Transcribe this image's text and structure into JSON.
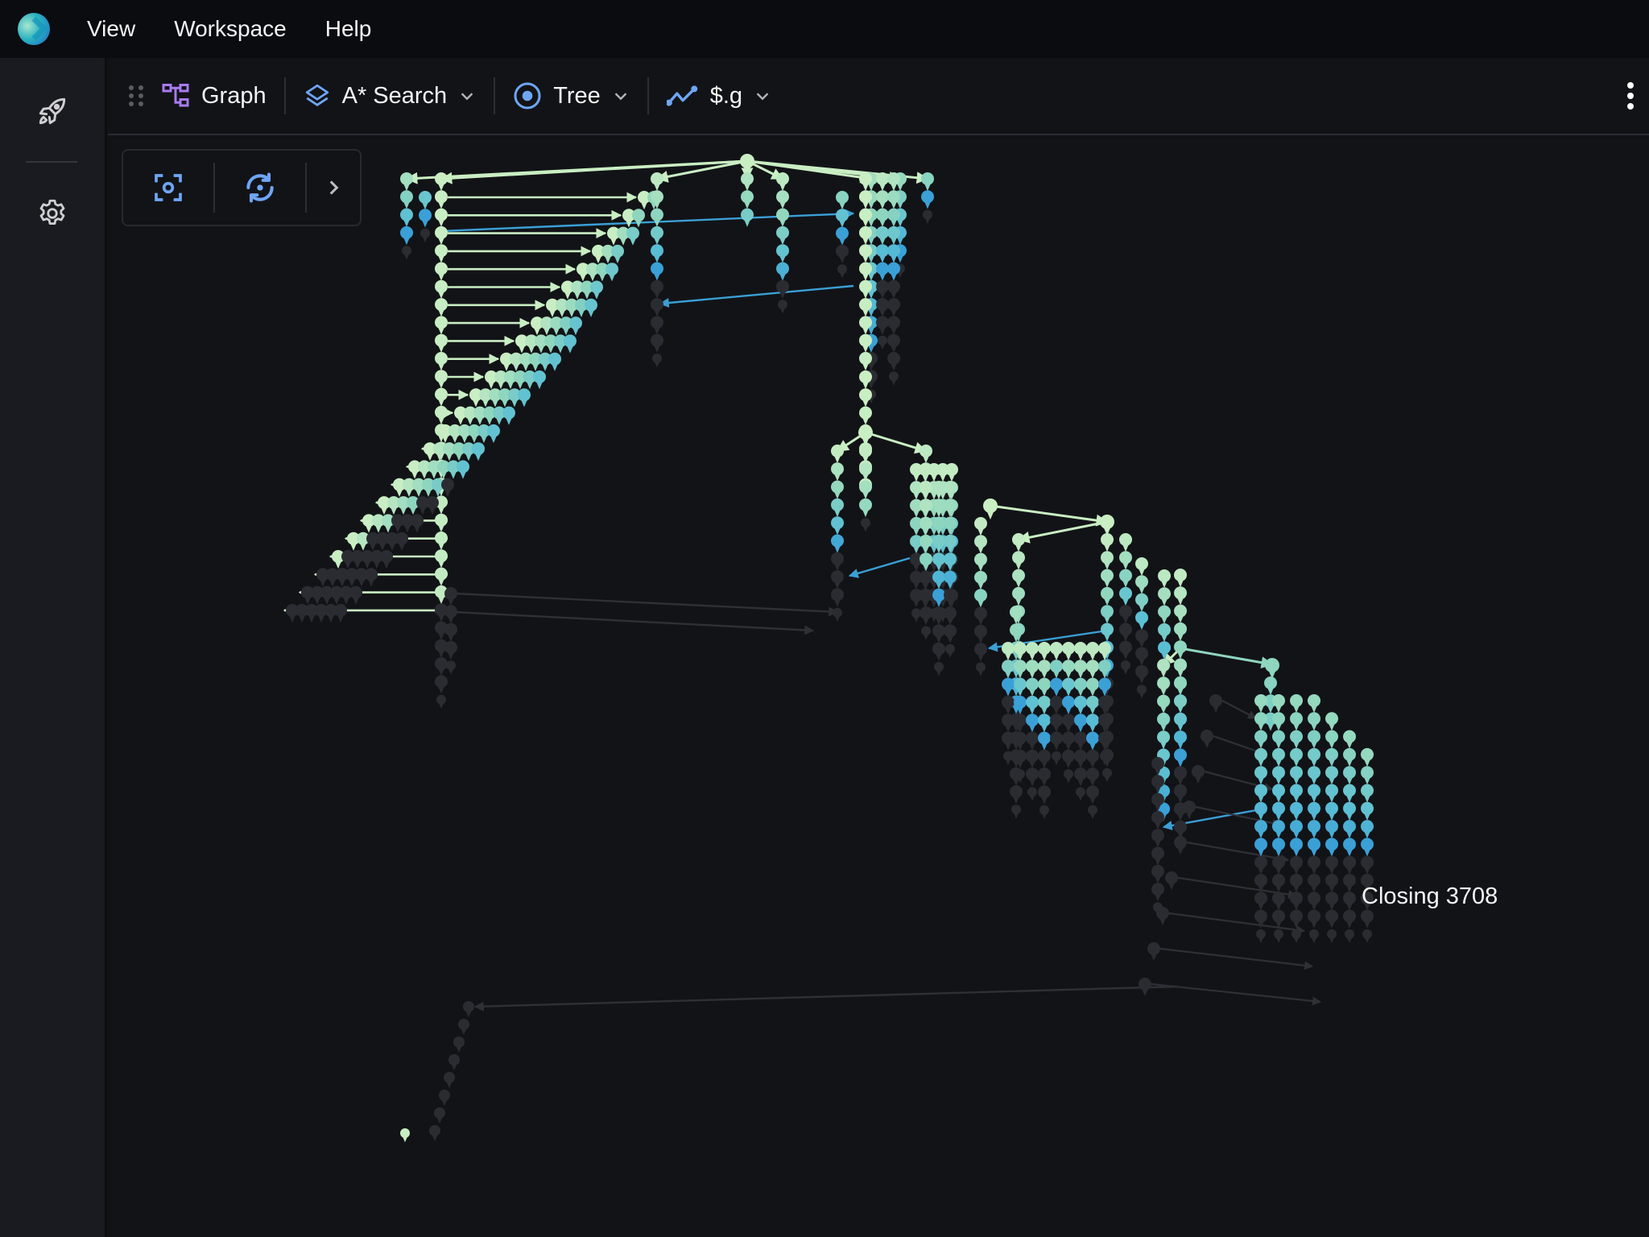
{
  "menubar": {
    "logo": "app-logo",
    "items": [
      {
        "label": "View"
      },
      {
        "label": "Workspace"
      },
      {
        "label": "Help"
      }
    ]
  },
  "sidebar": {
    "items": [
      {
        "icon": "rocket-icon",
        "name": "launch"
      },
      {
        "icon": "gear-icon",
        "name": "settings"
      }
    ]
  },
  "toolbar": {
    "graph_label": "Graph",
    "algorithm": {
      "label": "A* Search",
      "icon": "layers-icon"
    },
    "layout": {
      "label": "Tree",
      "icon": "target-icon"
    },
    "metric": {
      "label": "$.g",
      "icon": "line-chart-icon"
    }
  },
  "view_tools": {
    "fit_view": "focus-frame-icon",
    "reset_view": "rotate-view-icon",
    "expand": "chevron-right-icon"
  },
  "graph": {
    "hover_label": "Closing 3708",
    "colors": {
      "new": "#c9eec3",
      "mid": "#8fd6be",
      "open": "#5bbfd4",
      "closed": "#3aa0d6",
      "unvisited": "#2b2c32",
      "edge_dim": "#2f3036",
      "background": "#121317"
    }
  }
}
